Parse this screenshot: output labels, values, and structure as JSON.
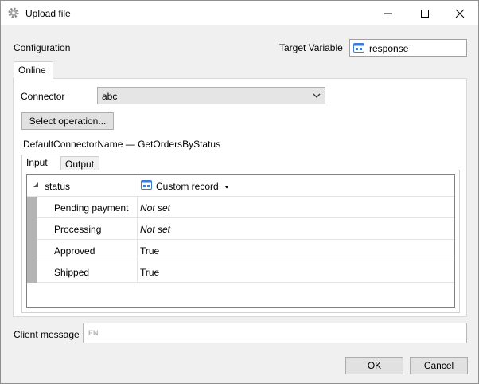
{
  "window": {
    "title": "Upload file",
    "icon": "gear-icon"
  },
  "configuration": {
    "label": "Configuration",
    "target_variable_label": "Target Variable",
    "target_variable_value": "response"
  },
  "tabs_outer": [
    {
      "label": "Online",
      "active": true
    }
  ],
  "connector": {
    "label": "Connector",
    "value": "abc"
  },
  "select_operation_label": "Select operation...",
  "operation_name": "DefaultConnectorName — GetOrdersByStatus",
  "tabs_inner": [
    {
      "label": "Input",
      "active": true
    },
    {
      "label": "Output",
      "active": false
    }
  ],
  "grid": {
    "group": {
      "name": "status",
      "type_label": "Custom record"
    },
    "rows": [
      {
        "name": "Pending payment",
        "value": "Not set"
      },
      {
        "name": "Processing",
        "value": "Not set"
      },
      {
        "name": "Approved",
        "value": "True"
      },
      {
        "name": "Shipped",
        "value": "True"
      }
    ]
  },
  "client_message": {
    "label": "Client message",
    "placeholder_badge": "EN"
  },
  "buttons": {
    "ok": "OK",
    "cancel": "Cancel"
  },
  "colors": {
    "accent_icon": "#3f7ad1",
    "gutter": "#b4b4b4"
  }
}
